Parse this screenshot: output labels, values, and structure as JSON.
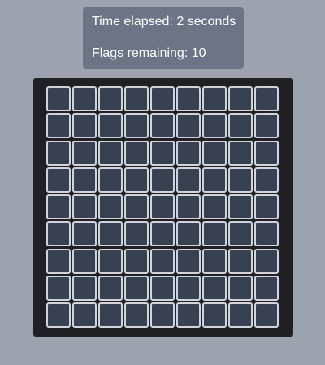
{
  "status": {
    "time_label": "Time elapsed: 2 seconds",
    "flags_label": "Flags remaining: 10"
  },
  "board": {
    "rows": 9,
    "columns": 9,
    "cell_state": "unrevealed",
    "colors": {
      "page_background": "#9ca3af",
      "panel_background": "#6b7585",
      "board_background": "#1f2124",
      "cell_fill": "#374151",
      "cell_border": "#d1d5db"
    }
  }
}
